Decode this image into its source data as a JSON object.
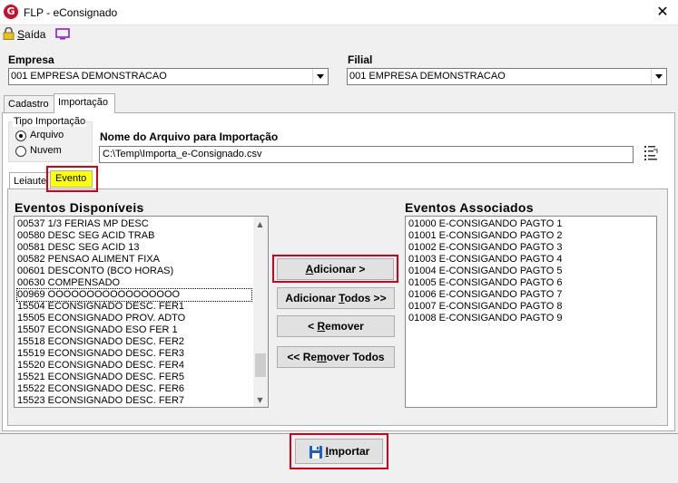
{
  "window": {
    "title": "FLP - eConsignado",
    "close_glyph": "✕"
  },
  "toolbar": {
    "exit_label_underlined": "S",
    "exit_label_rest": "aída"
  },
  "empresa": {
    "label": "Empresa",
    "value": "001 EMPRESA DEMONSTRACAO"
  },
  "filial": {
    "label": "Filial",
    "value": "001 EMPRESA DEMONSTRACAO"
  },
  "tabs": {
    "cadastro": "Cadastro",
    "importacao": "Importação"
  },
  "tipo_importacao": {
    "label": "Tipo Importação",
    "options": [
      "Arquivo",
      "Nuvem"
    ],
    "selected": "Arquivo"
  },
  "arquivo": {
    "label": "Nome do Arquivo para Importação",
    "value": "C:\\Temp\\Importa_e-Consignado.csv"
  },
  "subtabs": {
    "leiaute": "Leiaute",
    "evento": "Evento"
  },
  "disponiveis": {
    "title": "Eventos Disponíveis",
    "items": [
      "00537 1/3 FERIAS MP DESC",
      "00580 DESC SEG ACID TRAB",
      "00581 DESC SEG ACID 13",
      "00582 PENSAO ALIMENT FIXA",
      "00601 DESCONTO (BCO HORAS)",
      "00630 COMPENSADO",
      "00969 OOOOOOOOOOOOOOOOO",
      "15504 ECONSIGNADO DESC. FER1",
      "15505 ECONSIGNADO PROV. ADTO",
      "15507 ECONSIGNADO ESO FER 1",
      "15518 ECONSIGNADO DESC. FER2",
      "15519 ECONSIGNADO DESC. FER3",
      "15520 ECONSIGNADO DESC. FER4",
      "15521 ECONSIGNADO DESC. FER5",
      "15522 ECONSIGNADO DESC. FER6",
      "15523 ECONSIGNADO DESC. FER7"
    ]
  },
  "associados": {
    "title": "Eventos Associados",
    "items": [
      "01000 E-CONSIGANDO PAGTO 1",
      "01001 E-CONSIGANDO PAGTO 2",
      "01002 E-CONSIGANDO PAGTO 3",
      "01003 E-CONSIGANDO PAGTO 4",
      "01004 E-CONSIGANDO PAGTO 5",
      "01005 E-CONSIGANDO PAGTO 6",
      "01006 E-CONSIGANDO PAGTO 7",
      "01007 E-CONSIGANDO PAGTO 8",
      "01008 E-CONSIGANDO PAGTO 9"
    ]
  },
  "buttons": {
    "adicionar_u": "A",
    "adicionar_rest": "dicionar >",
    "adicionar_todos_pre": "Adicionar ",
    "adicionar_todos_u": "T",
    "adicionar_todos_rest": "odos >>",
    "remover_pre": "< ",
    "remover_u": "R",
    "remover_rest": "emover",
    "remover_todos_pre": "<< Re",
    "remover_todos_u": "m",
    "remover_todos_rest": "over Todos",
    "importar_u": "I",
    "importar_rest": "mportar"
  },
  "colors": {
    "highlight_tab": "#ffff00",
    "annotation_red": "#d0021b"
  }
}
